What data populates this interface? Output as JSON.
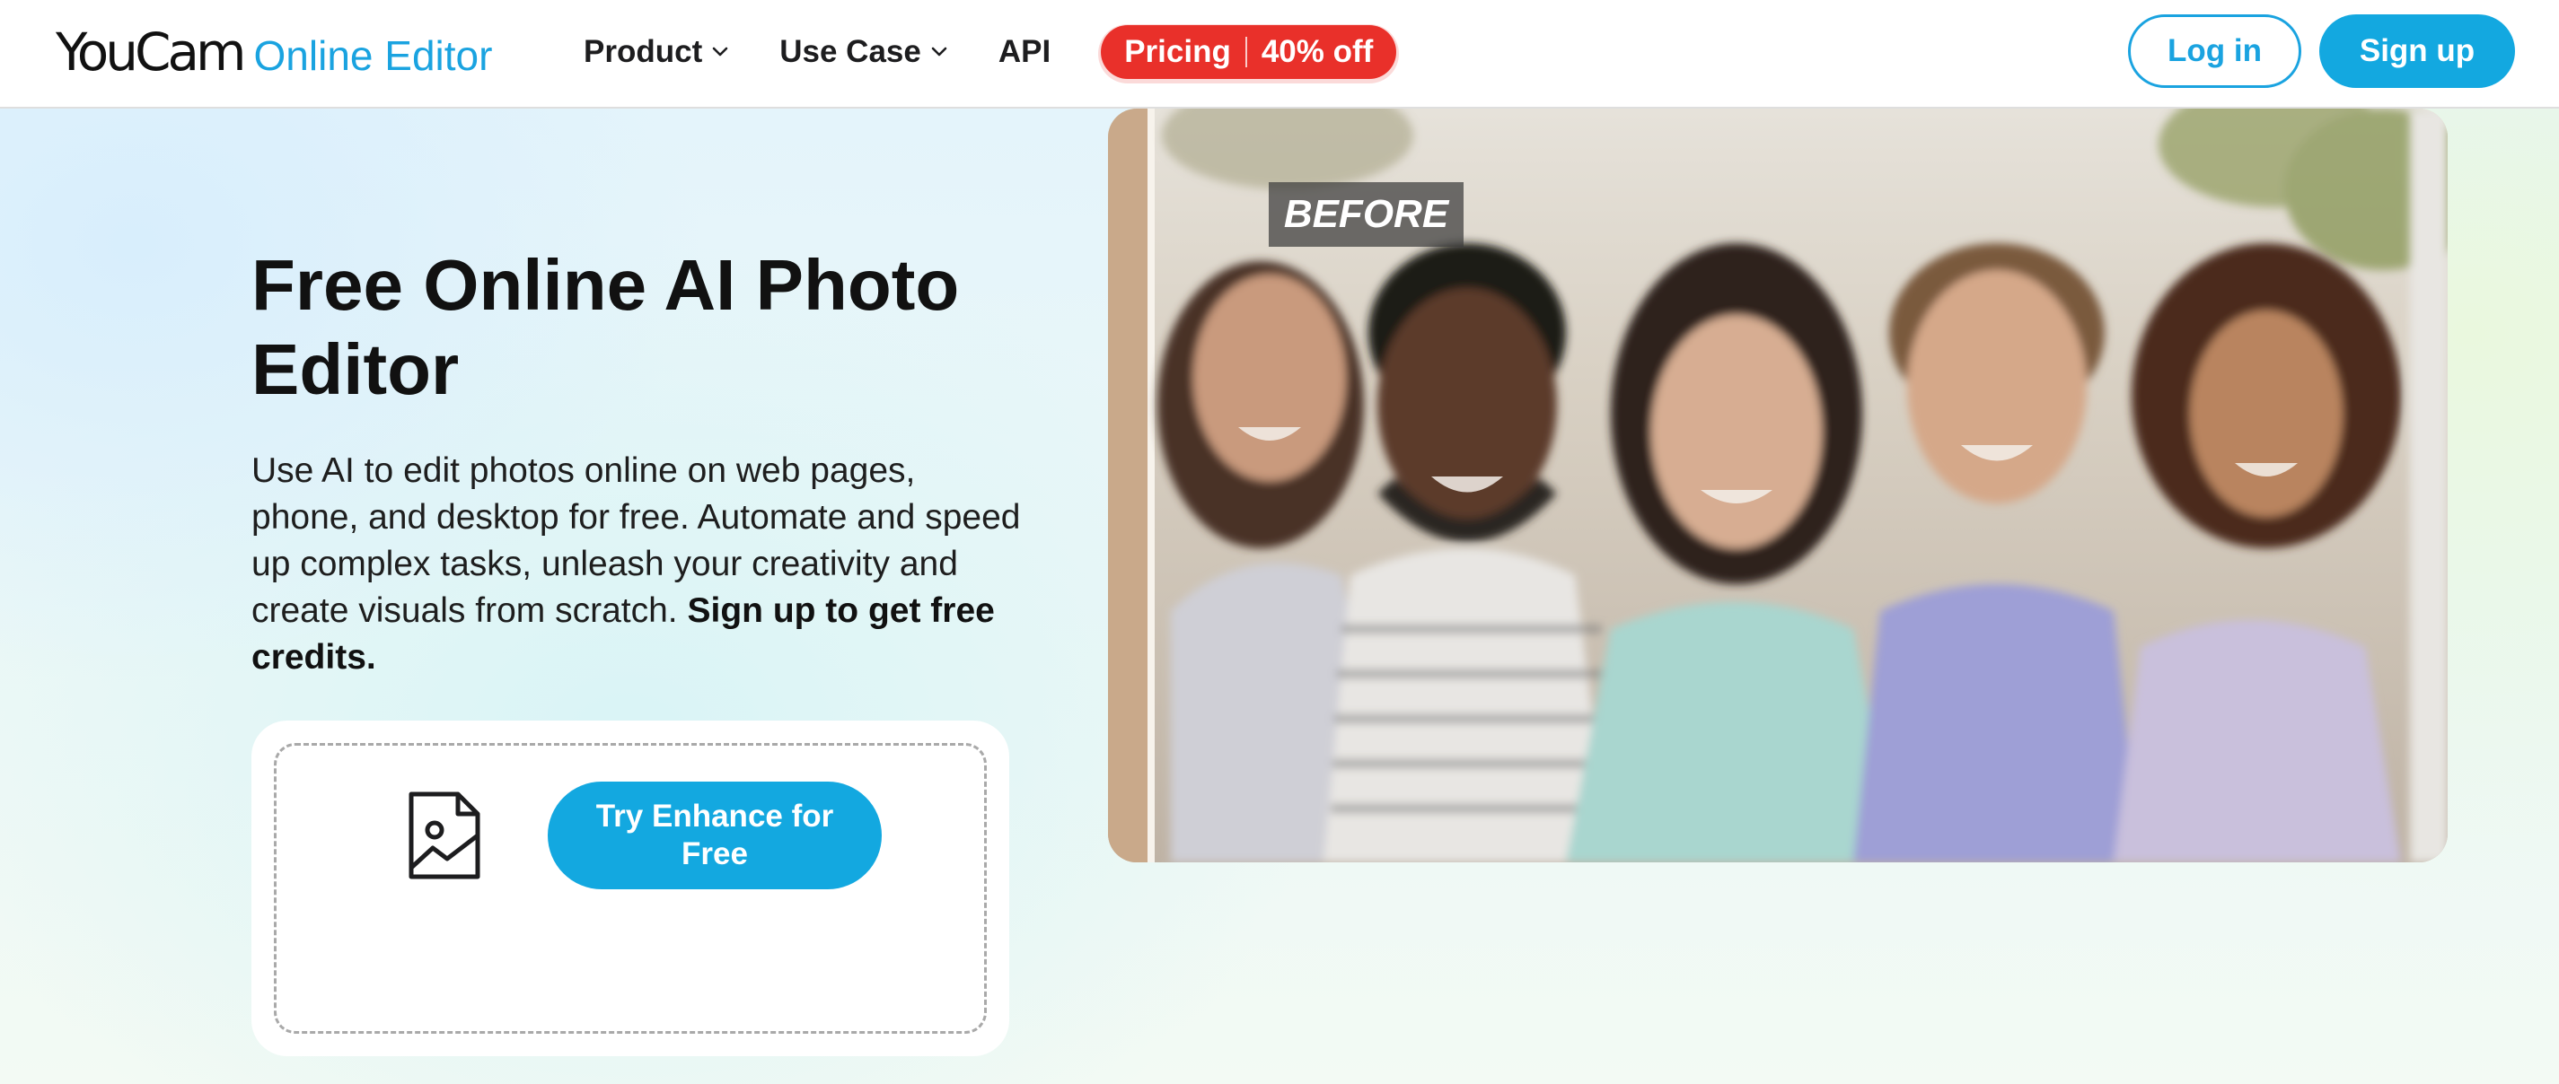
{
  "header": {
    "logo_brand": "YouCam",
    "logo_product": "Online Editor",
    "nav": {
      "product": "Product",
      "use_case": "Use Case",
      "api": "API"
    },
    "pricing": {
      "label": "Pricing",
      "discount": "40% off"
    },
    "login": "Log in",
    "signup": "Sign up"
  },
  "hero": {
    "title": "Free Online AI Photo Editor",
    "description": "Use AI to edit photos online on web pages, phone, and desktop for free. Automate and speed up complex tasks, unleash your creativity and create visuals from scratch. ",
    "description_bold": "Sign up to get free credits.",
    "cta": "Try Enhance for Free",
    "upload_icon": "image-file-icon"
  },
  "preview": {
    "before_label": "BEFORE",
    "colors": {
      "accent": "#13a8e0",
      "pricing_red": "#e9302a"
    }
  }
}
